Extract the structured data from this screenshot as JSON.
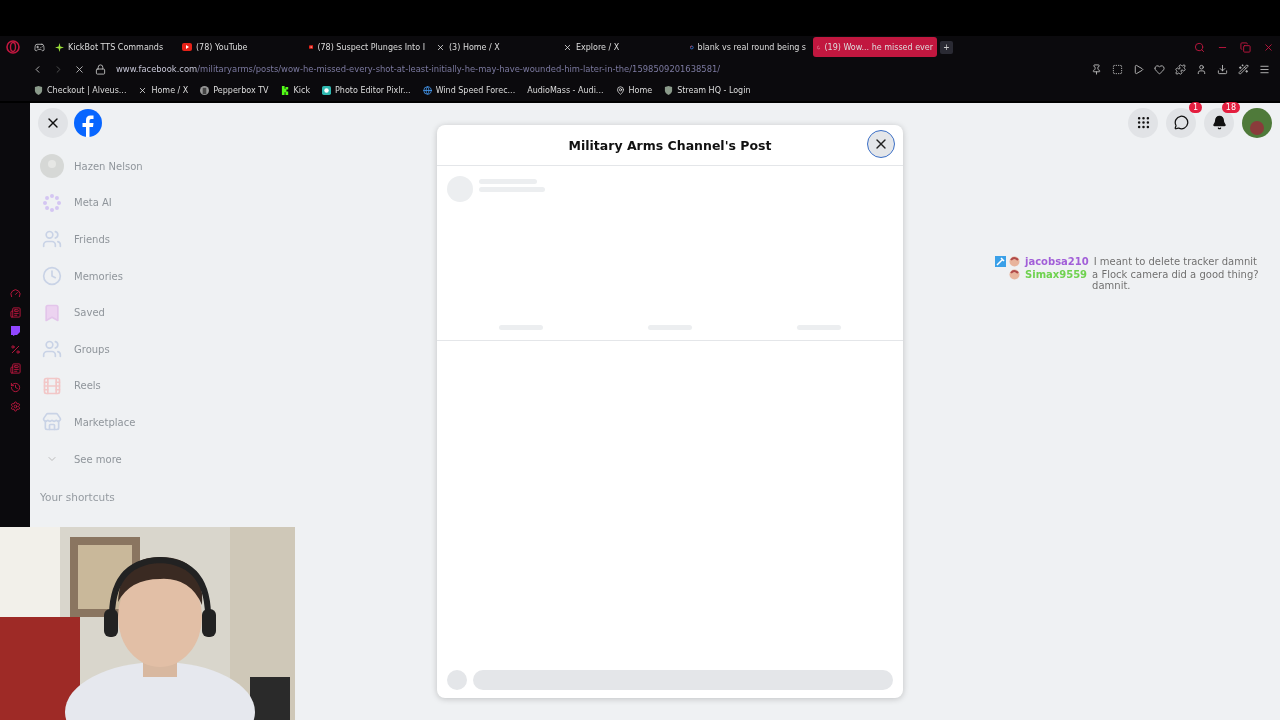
{
  "browser": {
    "tabs": [
      {
        "title": "KickBot TTS Commands",
        "kind": "kickbot",
        "selected": false
      },
      {
        "title": "(78) YouTube",
        "kind": "youtube",
        "selected": false
      },
      {
        "title": "(78) Suspect Plunges Into I",
        "kind": "youtube",
        "selected": false
      },
      {
        "title": "(3) Home / X",
        "kind": "x",
        "selected": false
      },
      {
        "title": "Explore / X",
        "kind": "x",
        "selected": false
      },
      {
        "title": "blank vs real round being s",
        "kind": "google",
        "selected": false
      },
      {
        "title": "(19) Wow... he missed ever",
        "kind": "loading",
        "selected": true
      }
    ],
    "new_tab": "+",
    "address_host": "www.facebook.com",
    "address_path": "/militaryarms/posts/wow-he-missed-every-shot-at-least-initially-he-may-have-wounded-him-later-in-the/1598509201638581/",
    "bookmarks": [
      {
        "title": "Checkout | Alveus...",
        "kind": "shield"
      },
      {
        "title": "Home / X",
        "kind": "x"
      },
      {
        "title": "Pepperbox TV",
        "kind": "pepper"
      },
      {
        "title": "Kick",
        "kind": "kick"
      },
      {
        "title": "Photo Editor Pixlr...",
        "kind": "pixlr"
      },
      {
        "title": "Wind Speed Forec...",
        "kind": "globe"
      },
      {
        "title": "AudioMass - Audi...",
        "kind": "plain"
      },
      {
        "title": "Home",
        "kind": "pin"
      },
      {
        "title": "Stream HQ - Login",
        "kind": "shield"
      }
    ]
  },
  "facebook": {
    "sidebar": [
      {
        "label": "Hazen Nelson",
        "kind": "avatar"
      },
      {
        "label": "Meta AI",
        "kind": "meta"
      },
      {
        "label": "Friends",
        "kind": "friends"
      },
      {
        "label": "Memories",
        "kind": "clock"
      },
      {
        "label": "Saved",
        "kind": "bookmark"
      },
      {
        "label": "Groups",
        "kind": "groups"
      },
      {
        "label": "Reels",
        "kind": "reels"
      },
      {
        "label": "Marketplace",
        "kind": "shop"
      },
      {
        "label": "See more",
        "kind": "chevron"
      }
    ],
    "shortcuts_heading": "Your shortcuts",
    "messenger_badge": "1",
    "notifications_badge": "18"
  },
  "post_dialog": {
    "title": "Military Arms Channel's Post"
  },
  "chat": [
    {
      "user": "jacobsa210",
      "color": "#a25fd8",
      "message": "I meant to delete tracker damnit",
      "moderator": true
    },
    {
      "user": "Simax9559",
      "color": "#6fd24f",
      "message": "a Flock camera did a good thing? damnit.",
      "moderator": false
    }
  ]
}
